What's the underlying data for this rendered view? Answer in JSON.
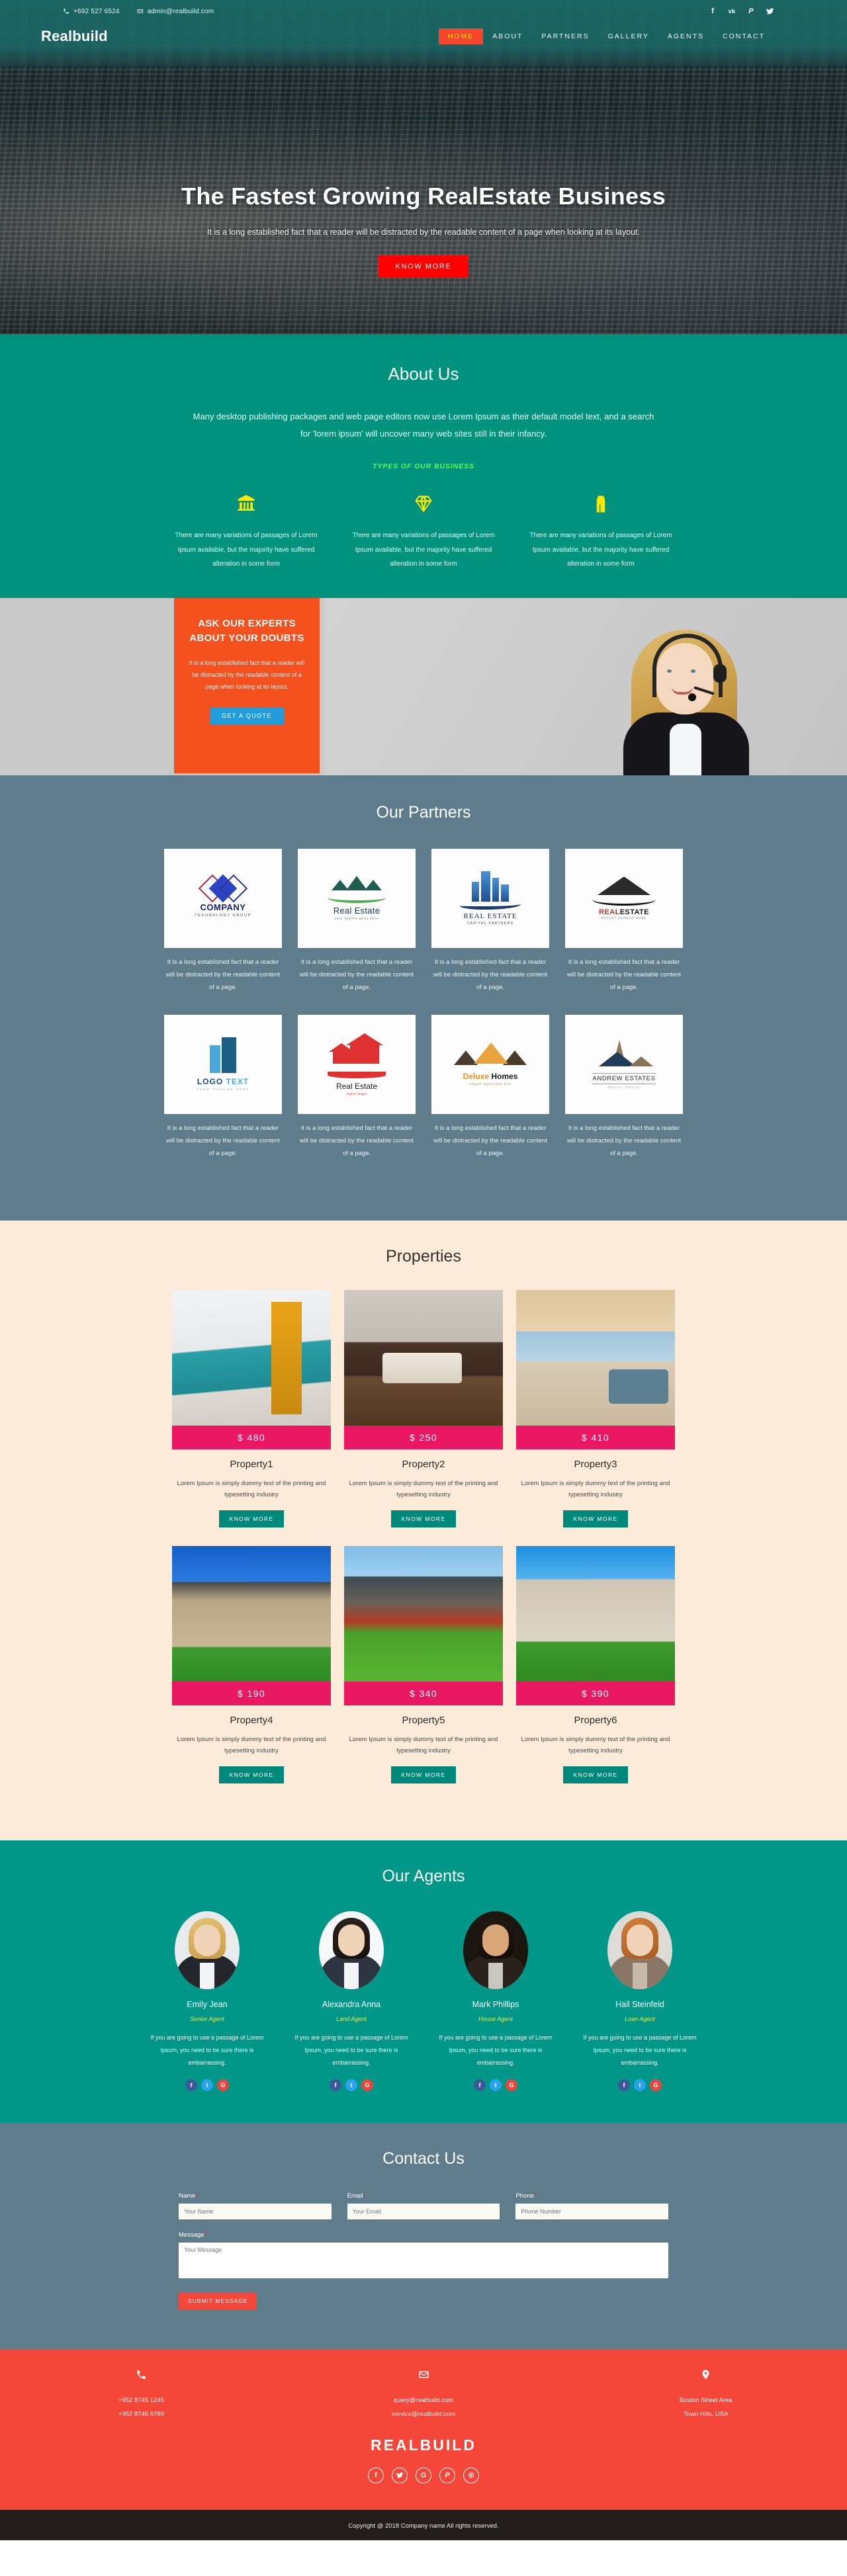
{
  "topbar": {
    "phone": "+692 527 6524",
    "email": "admin@realbuild.com",
    "socials": [
      "facebook-icon",
      "vk-icon",
      "pinterest-icon",
      "twitter-icon"
    ]
  },
  "header": {
    "brand": "Realbuild",
    "nav": [
      {
        "label": "HOME",
        "active": true
      },
      {
        "label": "ABOUT",
        "active": false
      },
      {
        "label": "PARTNERS",
        "active": false
      },
      {
        "label": "GALLERY",
        "active": false
      },
      {
        "label": "AGENTS",
        "active": false
      },
      {
        "label": "CONTACT",
        "active": false
      }
    ]
  },
  "hero": {
    "title": "The Fastest Growing RealEstate Business",
    "subtitle": "It is a long established fact that a reader will be distracted by the readable content of a page when looking at its layout.",
    "cta": "KNOW MORE",
    "cta_color": "#ff0000"
  },
  "about": {
    "title": "About Us",
    "lead": "Many desktop publishing packages and web page editors now use Lorem Ipsum as their default model text, and a search for 'lorem ipsum' will uncover many web sites still in their infancy.",
    "subtitle": "TYPES OF OUR BUSINESS",
    "subtitle_color": "#5dfd4e",
    "bg_color": "#00927d",
    "types": [
      {
        "icon": "bank-icon",
        "text": "There are many variations of passages of Lorem Ipsum available, but the majority have suffered alteration in some form"
      },
      {
        "icon": "diamond-icon",
        "text": "There are many variations of passages of Lorem Ipsum available, but the majority have suffered alteration in some form"
      },
      {
        "icon": "bridge-icon",
        "text": "There are many variations of passages of Lorem Ipsum available, but the majority have suffered alteration in some form"
      }
    ]
  },
  "experts": {
    "title": "ASK OUR EXPERTS ABOUT YOUR DOUBTS",
    "text": "It is a long established fact that a reader will be distracted by the readable content of a page when looking at its layout.",
    "cta": "GET A QUOTE",
    "card_color": "#f4511e",
    "cta_color": "#219ddb",
    "photo_alt": "call-center-agent-photo"
  },
  "partners": {
    "title": "Our Partners",
    "bg_color": "#5e7c8b",
    "items": [
      {
        "logo": "company-technology-group-logo",
        "name": "COMPANY",
        "tagline": "TECHNOLOGY GROUP",
        "desc": "It is a long established fact that a reader will be distracted by the readable content of a page."
      },
      {
        "logo": "real-estate-houses-logo",
        "name": "Real Estate",
        "tagline": "your tagline goes here",
        "desc": "It is a long established fact that a reader will be distracted by the readable content of a page."
      },
      {
        "logo": "real-estate-capital-partners-logo",
        "name": "REAL ESTATE",
        "tagline": "CAPITAL PARTNERS",
        "desc": "It is a long established fact that a reader will be distracted by the readable content of a page."
      },
      {
        "logo": "realestate-swoosh-logo",
        "name": "REALESTATE",
        "tagline": "REALTY SLOGAN HERE",
        "desc": "It is a long established fact that a reader will be distracted by the readable content of a page."
      },
      {
        "logo": "logo-text-building-logo",
        "name": "LOGO TEXT",
        "tagline": "YOUR TAGLINE HERE",
        "desc": "It is a long established fact that a reader will be distracted by the readable content of a page."
      },
      {
        "logo": "red-house-real-estate-logo",
        "name": "Real Estate",
        "tagline": "tagline / slogan",
        "desc": "It is a long established fact that a reader will be distracted by the readable content of a page."
      },
      {
        "logo": "deluxe-homes-logo",
        "name": "Deluxe Homes",
        "tagline": "Elegant tagline goes here",
        "desc": "It is a long established fact that a reader will be distracted by the readable content of a page."
      },
      {
        "logo": "andrew-estates-logo",
        "name": "ANDREW ESTATES",
        "tagline": "REALTY GROUP",
        "desc": "It is a long established fact that a reader will be distracted by the readable content of a page."
      }
    ]
  },
  "properties": {
    "title": "Properties",
    "bg_color": "#fbebd8",
    "price_color": "#ea1763",
    "button_color": "#00897b",
    "items": [
      {
        "price": "$ 480",
        "name": "Property1",
        "desc": "Lorem Ipsum is simply dummy text of the printing and typesetting industry",
        "cta": "KNOW MORE",
        "image": "kitchen-interior-photo"
      },
      {
        "price": "$ 250",
        "name": "Property2",
        "desc": "Lorem Ipsum is simply dummy text of the printing and typesetting industry",
        "cta": "KNOW MORE",
        "image": "bedroom-interior-photo"
      },
      {
        "price": "$ 410",
        "name": "Property3",
        "desc": "Lorem Ipsum is simply dummy text of the printing and typesetting industry",
        "cta": "KNOW MORE",
        "image": "living-room-interior-photo"
      },
      {
        "price": "$ 190",
        "name": "Property4",
        "desc": "Lorem Ipsum is simply dummy text of the printing and typesetting industry",
        "cta": "KNOW MORE",
        "image": "suburban-house-exterior-photo"
      },
      {
        "price": "$ 340",
        "name": "Property5",
        "desc": "Lorem Ipsum is simply dummy text of the printing and typesetting industry",
        "cta": "KNOW MORE",
        "image": "mountain-cottage-photo"
      },
      {
        "price": "$ 390",
        "name": "Property6",
        "desc": "Lorem Ipsum is simply dummy text of the printing and typesetting industry",
        "cta": "KNOW MORE",
        "image": "stone-mansion-photo"
      }
    ]
  },
  "agents": {
    "title": "Our Agents",
    "bg_color": "#009688",
    "role_color": "#d9f05a",
    "items": [
      {
        "name": "Emily Jean",
        "role": "Senior Agent",
        "desc": "If you are going to use a passage of Lorem Ipsum, you need to be sure there is embarrassing.",
        "photo": "blonde-businesswoman-photo",
        "socials": [
          "facebook-icon",
          "twitter-icon",
          "google-plus-icon"
        ]
      },
      {
        "name": "Alexandra Anna",
        "role": "Land Agent",
        "desc": "If you are going to use a passage of Lorem Ipsum, you need to be sure there is embarrassing.",
        "photo": "brunette-businesswoman-photo",
        "socials": [
          "facebook-icon",
          "twitter-icon",
          "google-plus-icon"
        ]
      },
      {
        "name": "Mark Phillips",
        "role": "House Agent",
        "desc": "If you are going to use a passage of Lorem Ipsum, you need to be sure there is embarrassing.",
        "photo": "businessman-photo",
        "socials": [
          "facebook-icon",
          "twitter-icon",
          "google-plus-icon"
        ]
      },
      {
        "name": "Hail Steinfeld",
        "role": "Loan Agent",
        "desc": "If you are going to use a passage of Lorem Ipsum, you need to be sure there is embarrassing.",
        "photo": "redhead-businesswoman-photo",
        "socials": [
          "facebook-icon",
          "twitter-icon",
          "google-plus-icon"
        ]
      }
    ]
  },
  "contact": {
    "title": "Contact Us",
    "bg_color": "#5e7c8b",
    "required_mark": "*",
    "fields": {
      "name_label": "Name",
      "name_placeholder": "Your Name",
      "email_label": "Email",
      "email_placeholder": "Your Email",
      "phone_label": "Phone",
      "phone_placeholder": "Phone Number",
      "message_label": "Message",
      "message_placeholder": "Your Message"
    },
    "submit": "SUBMIT MESSAGE",
    "submit_color": "#f4463b"
  },
  "footer": {
    "bg_color": "#f4473a",
    "phone_icon": "phone-icon",
    "phone_lines": [
      "+952 8745 1245",
      "+952 8745 6789"
    ],
    "email_icon": "envelope-icon",
    "email_lines": [
      "query@realbuild.com",
      "service@realbuild.com"
    ],
    "address_icon": "map-pin-icon",
    "address_lines": [
      "Boston Street Area",
      "Town Hills, USA"
    ],
    "brand": "REALBUILD",
    "socials": [
      "facebook-icon",
      "twitter-icon",
      "google-plus-icon",
      "pinterest-icon",
      "dribbble-icon"
    ],
    "copyright": "Copyright @ 2018 Company name All rights reserved."
  }
}
